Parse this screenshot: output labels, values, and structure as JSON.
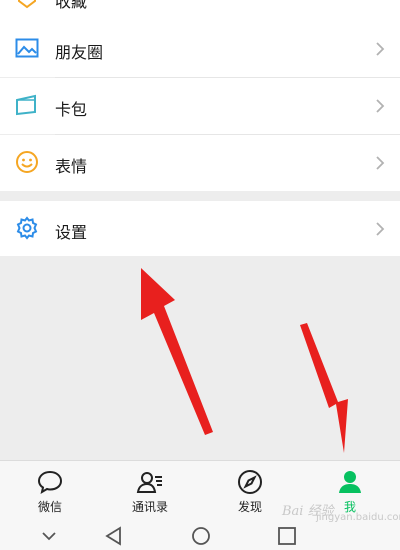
{
  "menu": {
    "partial_item": {
      "label": "收藏",
      "icon": "favorites-cube-icon"
    },
    "items": [
      {
        "label": "朋友圈",
        "icon": "photo-album-icon"
      },
      {
        "label": "卡包",
        "icon": "card-wallet-icon"
      },
      {
        "label": "表情",
        "icon": "smiley-face-icon"
      }
    ],
    "settings": {
      "label": "设置",
      "icon": "gear-icon"
    }
  },
  "tabbar": {
    "tabs": [
      {
        "label": "微信",
        "icon": "chat-bubble-icon",
        "active": false
      },
      {
        "label": "通讯录",
        "icon": "contacts-icon",
        "active": false
      },
      {
        "label": "发现",
        "icon": "compass-icon",
        "active": false
      },
      {
        "label": "我",
        "icon": "person-icon",
        "active": true
      }
    ]
  },
  "system_nav": {
    "buttons": [
      "chevron-down-icon",
      "back-triangle-icon",
      "home-circle-icon",
      "recents-square-icon"
    ]
  },
  "watermark": {
    "text": "Bai 经验",
    "url": "jingyan.baidu.com"
  },
  "colors": {
    "accent": "#07c160",
    "annotation_arrow": "#e8201e",
    "photo_icon": "#2c8ce8",
    "card_icon": "#3fb2c8",
    "emoji_icon": "#f5a623",
    "gear_icon": "#2c8ce8"
  }
}
